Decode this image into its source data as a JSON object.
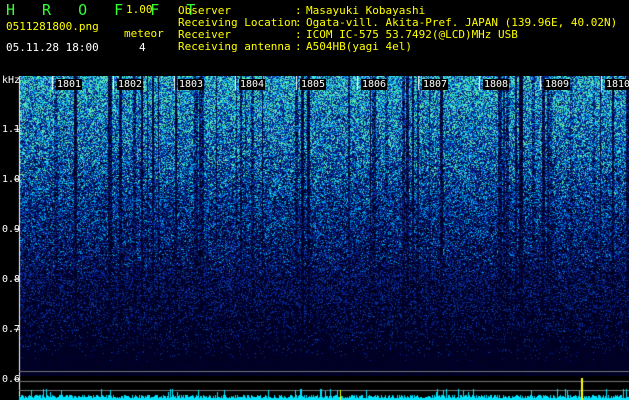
{
  "header": {
    "app_name": "H R O F F T",
    "version": "1.00",
    "filename": "0511281800.png",
    "datetime": "05.11.28 18:00",
    "meteor_label": "meteor",
    "meteor_count": "4",
    "fields": [
      {
        "label": "Observer",
        "value": "Masayuki Kobayashi"
      },
      {
        "label": "Receiving Location",
        "value": "Ogata-vill. Akita-Pref. JAPAN (139.96E, 40.02N)"
      },
      {
        "label": "Receiver",
        "value": "ICOM IC-575 53.7492(@LCD)MHz USB"
      },
      {
        "label": "Receiving antenna",
        "value": "A504HB(yagi 4el)"
      }
    ],
    "colon": ":"
  },
  "spectrogram": {
    "y_unit": "kHz",
    "y_ticks": [
      "1.1",
      "1.0",
      "0.9",
      "0.8",
      "0.7",
      "0.6"
    ],
    "time_labels": [
      "1801",
      "1802",
      "1803",
      "1804",
      "1805",
      "1806",
      "1807",
      "1808",
      "1809",
      "1810"
    ]
  },
  "colors": {
    "background": "#000000",
    "noise_low": "#0a1a6e",
    "noise_high": "#33ffcc",
    "header_text": "#ffff00",
    "logo": "#33ff33",
    "baseline": "#00e5ff",
    "meteor_mark": "#ffff00"
  }
}
